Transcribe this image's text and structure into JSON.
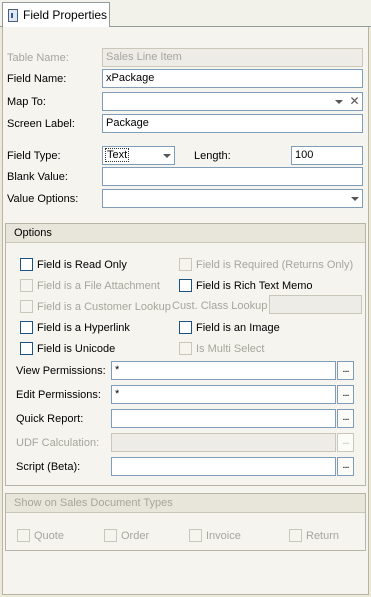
{
  "tab": {
    "label": "Field Properties"
  },
  "fields": {
    "table_name": {
      "label": "Table Name:",
      "value": "Sales Line Item"
    },
    "field_name": {
      "label": "Field Name:",
      "value": "xPackage"
    },
    "map_to": {
      "label": "Map To:",
      "value": ""
    },
    "screen_label": {
      "label": "Screen Label:",
      "value": "Package"
    },
    "field_type": {
      "label": "Field Type:",
      "value": "Text"
    },
    "length": {
      "label": "Length:",
      "value": "100"
    },
    "blank_value": {
      "label": "Blank Value:",
      "value": ""
    },
    "value_options": {
      "label": "Value Options:",
      "value": ""
    }
  },
  "options": {
    "header": "Options",
    "read_only": {
      "label": "Field is Read Only",
      "checked": false
    },
    "required": {
      "label": "Field is Required (Returns Only)",
      "checked": false
    },
    "file_attachment": {
      "label": "Field is a File Attachment",
      "checked": false
    },
    "rich_text": {
      "label": "Field is Rich Text Memo",
      "checked": false
    },
    "customer_lookup": {
      "label": "Field is a Customer Lookup",
      "checked": false
    },
    "cust_class_lookup": {
      "label": "Cust. Class Lookup",
      "value": ""
    },
    "hyperlink": {
      "label": "Field is a Hyperlink",
      "checked": false
    },
    "image": {
      "label": "Field is an Image",
      "checked": false
    },
    "unicode": {
      "label": "Field is Unicode",
      "checked": false
    },
    "multi_select": {
      "label": "Is Multi Select",
      "checked": false
    },
    "view_permissions": {
      "label": "View Permissions:",
      "value": "*"
    },
    "edit_permissions": {
      "label": "Edit Permissions:",
      "value": "*"
    },
    "quick_report": {
      "label": "Quick Report:",
      "value": ""
    },
    "udf_calculation": {
      "label": "UDF Calculation:",
      "value": ""
    },
    "script": {
      "label": "Script (Beta):",
      "value": ""
    },
    "ellipsis": "..."
  },
  "doc_types": {
    "header": "Show on Sales Document Types",
    "quote": "Quote",
    "order": "Order",
    "invoice": "Invoice",
    "return": "Return"
  },
  "colors": {
    "background": "#ece9d8",
    "panel": "#f5f4ee",
    "input_border": "#7f9db9",
    "disabled_text": "#a6a59d"
  }
}
